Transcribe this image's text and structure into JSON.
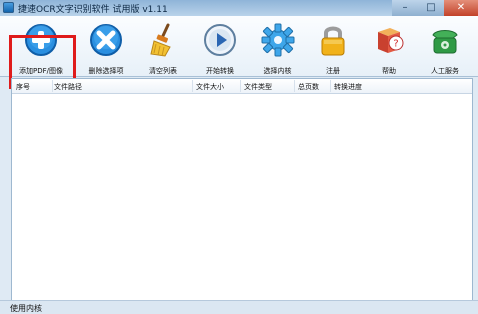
{
  "window": {
    "title": "捷速OCR文字识别软件 试用版 v1.11",
    "controls": [
      "minimize",
      "maximize",
      "close"
    ]
  },
  "toolbar": {
    "buttons": [
      {
        "label": "添加PDF/图像",
        "icon": "plus-icon",
        "selected": true
      },
      {
        "label": "删除选择项",
        "icon": "delete-x-icon"
      },
      {
        "label": "清空列表",
        "icon": "broom-icon"
      },
      {
        "label": "开始转换",
        "icon": "play-icon"
      },
      {
        "label": "选择内核",
        "icon": "gear-icon"
      },
      {
        "label": "注册",
        "icon": "lock-icon"
      },
      {
        "label": "帮助",
        "icon": "help-book-icon"
      },
      {
        "label": "人工服务",
        "icon": "phone-icon"
      }
    ]
  },
  "file_list": {
    "columns": [
      "序号",
      "文件路径",
      "文件大小",
      "文件类型",
      "总页数",
      "转换进度"
    ],
    "rows": []
  },
  "status": {
    "text": "使用内核"
  },
  "colors": {
    "accent_red": "#df1b1b",
    "title_blue": "#8fb4d8"
  }
}
